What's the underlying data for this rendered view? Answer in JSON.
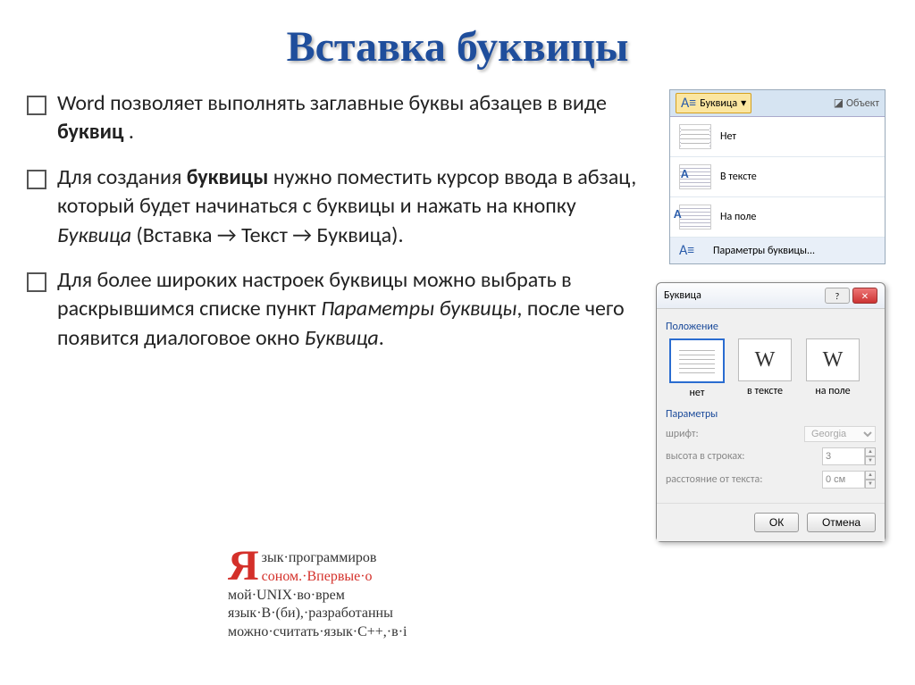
{
  "title": "Вставка буквицы",
  "paras": {
    "p1_a": "Word позволяет выполнять заглавные буквы абзацев в виде ",
    "p1_b": "буквиц",
    "p1_c": " .",
    "p2_a": "Для создания ",
    "p2_b": "буквицы",
    "p2_c": " нужно поместить курсор ввода в абзац, который будет начинаться с буквицы и нажать на кнопку ",
    "p2_d": "Буквица",
    "p2_e": " (Вставка → Текст → Буквица).",
    "p3_a": "Для более широких настроек буквицы можно выбрать в раскрывшимся списке пункт ",
    "p3_b": "Параметры буквицы",
    "p3_c": ", после чего появится диалоговое окно ",
    "p3_d": "Буквица",
    "p3_e": "."
  },
  "ribbon": {
    "button": "Буквица",
    "object": "Объект",
    "opt_none": "Нет",
    "opt_intext": "В тексте",
    "opt_margin": "На поле",
    "params": "Параметры буквицы..."
  },
  "dialog": {
    "title": "Буквица",
    "section_pos": "Положение",
    "opt_none": "нет",
    "opt_intext": "в тексте",
    "opt_margin": "на поле",
    "section_params": "Параметры",
    "lbl_font": "шрифт:",
    "val_font": "Georgia",
    "lbl_height": "высота в строках:",
    "val_height": "3",
    "lbl_dist": "расстояние от текста:",
    "val_dist": "0 см",
    "btn_ok": "ОК",
    "btn_cancel": "Отмена"
  },
  "example": {
    "dropcap": "Я",
    "l1": "зык·программиров",
    "l2": "соном.·Впервые·о",
    "l3": "мой·UNIX·во·врем",
    "l4": "язык·B·(би),·разработанны",
    "l5": "можно·считать·язык·C++,·в·і"
  }
}
